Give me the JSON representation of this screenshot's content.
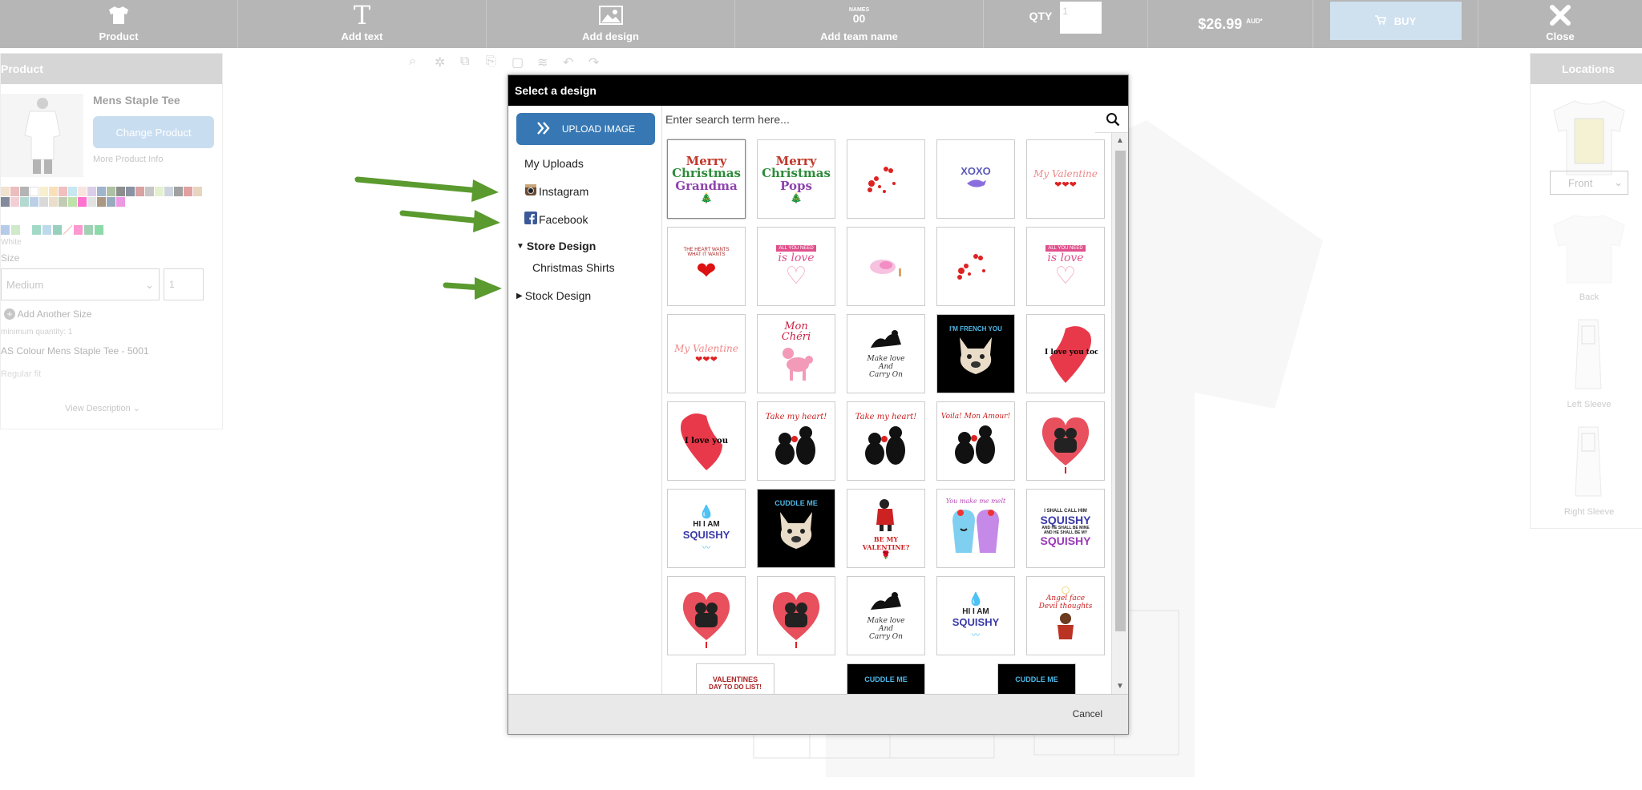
{
  "toolbar": {
    "product": "Product",
    "add_text": "Add text",
    "add_design": "Add design",
    "team_icon_top": "NAMES",
    "team_icon_bottom": "00",
    "add_team_name": "Add team name",
    "qty_label": "QTY",
    "qty_value": "1",
    "price": "$26.99",
    "price_currency": "AUD",
    "price_mark": "*",
    "buy": "BUY",
    "close": "Close"
  },
  "product_panel": {
    "title": "Product",
    "name": "Mens Staple Tee",
    "change_button": "Change Product",
    "more_info": "More Product Info",
    "color_name": "White",
    "size_label": "Size",
    "size_value": "Medium",
    "size_qty": "1",
    "add_size": "Add Another Size",
    "min_qty": "minimum quantity: 1",
    "sku": "AS Colour Mens Staple Tee - 5001",
    "fit": "Regular fit",
    "view_description": "View Description"
  },
  "locations_panel": {
    "title": "Locations",
    "front_option": "Front",
    "back": "Back",
    "left_sleeve": "Left Sleeve",
    "right_sleeve": "Right Sleeve"
  },
  "colors": {
    "accent": "#3778b4",
    "toolbar": "#b6b6b6",
    "arrow": "#5a9a2e"
  },
  "modal": {
    "title": "Select a design",
    "upload_button": "UPLOAD IMAGE",
    "search_placeholder": "Enter search term here...",
    "sidebar": {
      "my_uploads": "My Uploads",
      "instagram": "Instagram",
      "facebook": "Facebook",
      "store_design": "Store Design",
      "christmas_shirts": "Christmas Shirts",
      "stock_design": "Stock Design"
    },
    "cancel": "Cancel",
    "designs": {
      "d1_l1": "Merry",
      "d1_l2": "Christmas",
      "d1_l3": "Grandma",
      "d2_l1": "Merry",
      "d2_l2": "Christmas",
      "d2_l3": "Pops",
      "d4": "XOXO",
      "d5": "My Valentine",
      "d6": "THE HEART WANTS WHAT IT WANTS",
      "d7_top": "ALL YOU NEED",
      "d7_bottom": "is love",
      "d10_top": "ALL YOU NEED",
      "d10_bottom": "is love",
      "d11": "My Valentine",
      "d12": "Mon Chéri",
      "d13_l1": "Make love",
      "d13_l2": "And",
      "d13_l3": "Carry On",
      "d14": "I'M FRENCH YOU",
      "d15": "I love you too",
      "d16": "I love you",
      "d17": "Take my heart!",
      "d18": "Take my heart!",
      "d19": "Voila! Mon Amour!",
      "d21_l1": "HI I AM",
      "d21_l2": "SQUISHY",
      "d22": "CUDDLE ME",
      "d23": "BE MY VALENTINE?",
      "d24": "You make me melt",
      "d25_l1": "I SHALL CALL HIM",
      "d25_l2": "SQUISHY",
      "d25_l3": "AND HE SHALL BE MINE",
      "d25_l4": "AND HE SHALL BE MY",
      "d25_l5": "SQUISHY",
      "d28_l1": "Make love",
      "d28_l2": "And",
      "d28_l3": "Carry On",
      "d29_l1": "HI I AM",
      "d29_l2": "SQUISHY",
      "d30_l1": "Angel face",
      "d30_l2": "Devil thoughts",
      "d31_l1": "VALENTINES",
      "d31_l2": "DAY TO DO LIST!",
      "d32": "CUDDLE ME",
      "d33": "CUDDLE ME"
    }
  }
}
